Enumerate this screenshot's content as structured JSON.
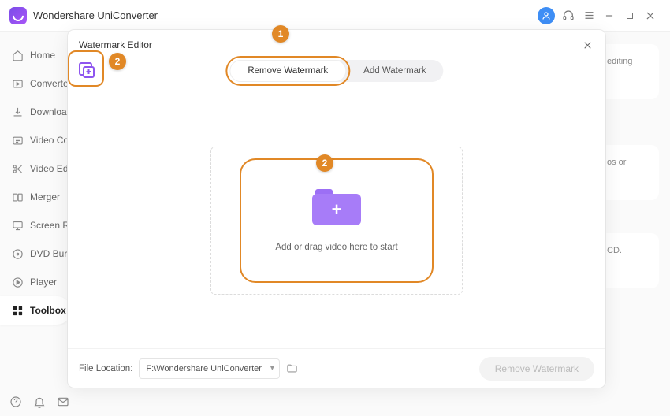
{
  "app": {
    "title": "Wondershare UniConverter"
  },
  "sidebar": {
    "items": [
      {
        "label": "Home"
      },
      {
        "label": "Converter"
      },
      {
        "label": "Downloader"
      },
      {
        "label": "Video Compressor"
      },
      {
        "label": "Video Editor"
      },
      {
        "label": "Merger"
      },
      {
        "label": "Screen Recorder"
      },
      {
        "label": "DVD Burner"
      },
      {
        "label": "Player"
      },
      {
        "label": "Toolbox"
      }
    ]
  },
  "bg": {
    "card1": "editing",
    "card2": "os or",
    "card3": "CD."
  },
  "modal": {
    "title": "Watermark Editor",
    "tabs": {
      "remove": "Remove Watermark",
      "add": "Add Watermark"
    },
    "dropzone_text": "Add or drag video here to start",
    "footer": {
      "label": "File Location:",
      "path": "F:\\Wondershare UniConverter",
      "action": "Remove Watermark"
    }
  },
  "callouts": {
    "one": "1",
    "two_a": "2",
    "two_b": "2"
  }
}
